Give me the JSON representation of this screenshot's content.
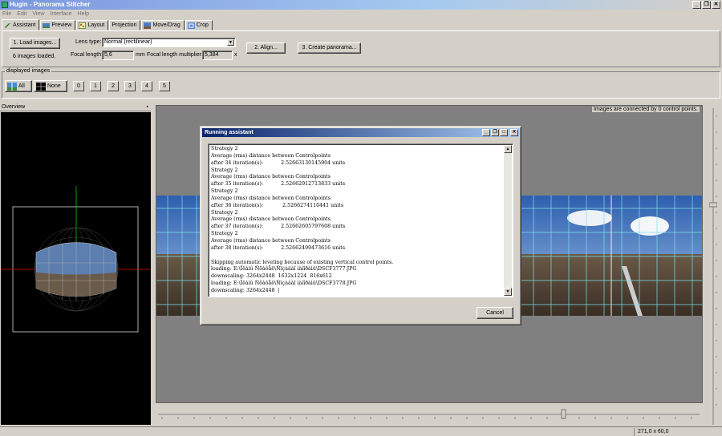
{
  "window": {
    "title": "Hugin - Panorama Stitcher",
    "buttons": [
      "_",
      "❐",
      "✕"
    ]
  },
  "menu": [
    "File",
    "Edit",
    "View",
    "Interface",
    "Help"
  ],
  "tabs": [
    {
      "label": "Assistant",
      "icon": "wizard-icon",
      "active": true
    },
    {
      "label": "Preview",
      "icon": "preview-icon"
    },
    {
      "label": "Layout",
      "icon": "layout-icon"
    },
    {
      "label": "Projection",
      "icon": "projection-icon"
    },
    {
      "label": "Move/Drag",
      "icon": "move-drag-icon"
    },
    {
      "label": "Crop",
      "icon": "crop-icon"
    }
  ],
  "assistant": {
    "load_images_label": "1. Load images...",
    "images_loaded": "6 images loaded.",
    "lens_type_label": "Lens type:",
    "lens_type_value": "Normal (rectilinear)",
    "focal_length_label": "Focal length:",
    "focal_length_value": "5,6",
    "focal_length_unit": "mm",
    "multiplier_label": "Focal length multiplier:",
    "multiplier_value": "5,384",
    "multiplier_unit": "x",
    "align_label": "2. Align...",
    "create_label": "3. Create panorama..."
  },
  "displayed_images": {
    "title": "displayed images",
    "all_label": "All",
    "none_label": "None",
    "numbers": [
      "0",
      "1",
      "2",
      "3",
      "4",
      "5"
    ]
  },
  "overview": {
    "title": "Overview",
    "pin": "▪"
  },
  "preview": {
    "status": "Images are connected by 0 control points."
  },
  "statusbar": {
    "coords": "271,0 x 60,0"
  },
  "dialog": {
    "title": "Running assistant",
    "buttons": [
      "_",
      "❐",
      "□",
      "✕"
    ],
    "cancel_label": "Cancel",
    "log": "Strategy 2\nAverage (rms) distance between Controlpoints\nafter 34 iteration(s):           2.52663130145904 units\nStrategy 2\nAverage (rms) distance between Controlpoints\nafter 35 iteration(s):           2.52662912713833 units\nStrategy 2\nAverage (rms) distance between Controlpoints\nafter 36 iteration(s):            2.5266274110441 units\nStrategy 2\nAverage (rms) distance between Controlpoints\nafter 37 iteration(s):           2.52662605797608 units\nStrategy 2\nAverage (rms) distance between Controlpoints\nafter 38 iteration(s):           2.52662499473616 units\n\nSkipping automatic leveling because of existing vertical control points.\nloading: E:\\Ïëàíû Ñõàôåë\\Ñïçàäàî ìàíîðàìû\\DSCF3777.JPG\ndownscaling: 3264x2448  1632x1224  816x612\nloading: E:\\Ïëàíû Ñõàôåë\\Ñïçàäàî ìàíîðàìû\\DSCF3778.JPG\ndownscaling: 3264x2448  |"
  },
  "colors": {
    "titlebar": "#7a96df",
    "dialog_titlebar": "#0a246a",
    "face": "#d4d0c8",
    "preview_bg": "#808080",
    "grid": "#7fe0e8"
  }
}
